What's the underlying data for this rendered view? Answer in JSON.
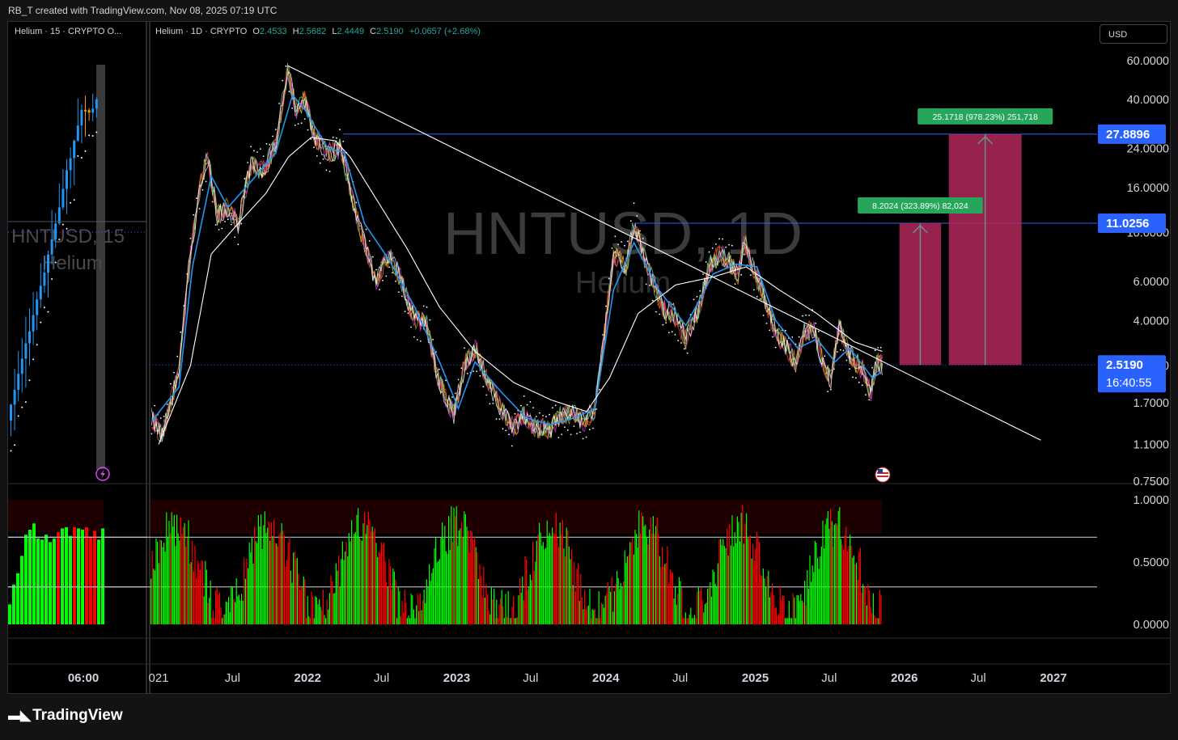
{
  "header": {
    "credit": "RB_T created with TradingView.com, Nov 08, 2025 07:19 UTC"
  },
  "footer": {
    "brand": "TradingView",
    "logo_icon": "tradingview-logo-icon"
  },
  "currency_button": "USD",
  "left_pane": {
    "legend": "Helium · 15 · CRYPTO  O...",
    "watermark_symbol": "HNTUSD, 15",
    "watermark_name": "Helium",
    "time_label": "06:00",
    "alert_icon": "lightning-alert-icon"
  },
  "main_pane": {
    "legend": {
      "name": "Helium · 1D · CRYPTO",
      "o_label": "O",
      "o_value": "2.4533",
      "h_label": "H",
      "h_value": "2.5682",
      "l_label": "L",
      "l_value": "2.4449",
      "c_label": "C",
      "c_value": "2.5190",
      "change": "+0.0657 (+2.68%)"
    },
    "watermark_symbol": "HNTUSD, 1D",
    "watermark_name": "Helium",
    "flag_icon": "us-flag-icon"
  },
  "colors": {
    "background": "#000000",
    "up": "#00ff00",
    "down": "#ff0000",
    "accent_blue": "#2962ff",
    "target_box": "#b2285a",
    "label_green": "#26a65b",
    "ma_fast": "#2196f3",
    "ma_slow": "#ffffff"
  },
  "chart_data": [
    {
      "type": "line",
      "scale": "log",
      "x_axis": {
        "tick_labels": [
          "021",
          "Jul",
          "2022",
          "Jul",
          "2023",
          "Jul",
          "2024",
          "Jul",
          "2025",
          "Jul",
          "2026",
          "Jul",
          "2027"
        ],
        "bold_ticks": [
          "2022",
          "2023",
          "2024",
          "2025",
          "2026",
          "2027"
        ]
      },
      "y_axis": {
        "tick_values": [
          60,
          40,
          24,
          16,
          10,
          6,
          4,
          2.5,
          1.7,
          1.1,
          0.75
        ],
        "tick_labels": [
          "60.0000",
          "40.0000",
          "24.0000",
          "16.0000",
          "10.0000",
          "6.0000",
          "4.0000",
          "2.5000",
          "1.7000",
          "1.1000",
          "0.7500"
        ],
        "ylim": [
          0.72,
          78
        ]
      },
      "price_labels": [
        {
          "value": 27.8896,
          "label": "27.8896"
        },
        {
          "value": 11.0256,
          "label": "11.0256"
        },
        {
          "value": 2.519,
          "label": "2.5190",
          "countdown": "16:40:55"
        }
      ],
      "series": [
        {
          "role": "price",
          "points": [
            [
              "2020-12-15",
              1.45
            ],
            [
              "2021-01-10",
              1.2
            ],
            [
              "2021-02-20",
              2.4
            ],
            [
              "2021-03-20",
              8
            ],
            [
              "2021-04-15",
              17
            ],
            [
              "2021-05-01",
              22
            ],
            [
              "2021-05-25",
              12
            ],
            [
              "2021-06-20",
              13
            ],
            [
              "2021-07-15",
              11
            ],
            [
              "2021-08-15",
              20
            ],
            [
              "2021-09-15",
              19
            ],
            [
              "2021-10-15",
              25
            ],
            [
              "2021-11-13",
              55
            ],
            [
              "2021-12-05",
              35
            ],
            [
              "2021-12-25",
              40
            ],
            [
              "2022-01-20",
              27
            ],
            [
              "2022-02-20",
              23
            ],
            [
              "2022-03-25",
              24
            ],
            [
              "2022-04-30",
              12
            ],
            [
              "2022-05-20",
              9
            ],
            [
              "2022-06-18",
              6
            ],
            [
              "2022-07-20",
              8
            ],
            [
              "2022-08-20",
              6
            ],
            [
              "2022-09-15",
              4.2
            ],
            [
              "2022-10-20",
              3.8
            ],
            [
              "2022-11-15",
              2.2
            ],
            [
              "2022-12-25",
              1.5
            ],
            [
              "2023-01-20",
              2.5
            ],
            [
              "2023-02-15",
              3
            ],
            [
              "2023-03-15",
              2.2
            ],
            [
              "2023-04-20",
              1.6
            ],
            [
              "2023-05-20",
              1.3
            ],
            [
              "2023-06-15",
              1.5
            ],
            [
              "2023-07-15",
              1.3
            ],
            [
              "2023-08-20",
              1.3
            ],
            [
              "2023-09-15",
              1.5
            ],
            [
              "2023-10-15",
              1.5
            ],
            [
              "2023-11-10",
              1.4
            ],
            [
              "2023-12-05",
              1.6
            ],
            [
              "2023-12-25",
              3
            ],
            [
              "2024-01-20",
              8
            ],
            [
              "2024-02-20",
              7
            ],
            [
              "2024-03-10",
              11
            ],
            [
              "2024-04-01",
              8
            ],
            [
              "2024-04-25",
              6
            ],
            [
              "2024-05-20",
              4.5
            ],
            [
              "2024-06-15",
              4.3
            ],
            [
              "2024-07-15",
              3.3
            ],
            [
              "2024-08-15",
              4.5
            ],
            [
              "2024-09-10",
              7
            ],
            [
              "2024-10-05",
              8
            ],
            [
              "2024-10-25",
              7.5
            ],
            [
              "2024-11-20",
              6.5
            ],
            [
              "2024-12-05",
              9.3
            ],
            [
              "2024-12-25",
              7
            ],
            [
              "2025-01-25",
              5
            ],
            [
              "2025-02-20",
              3.5
            ],
            [
              "2025-03-20",
              3
            ],
            [
              "2025-04-10",
              2.6
            ],
            [
              "2025-05-01",
              3.6
            ],
            [
              "2025-05-25",
              3.6
            ],
            [
              "2025-06-20",
              2.4
            ],
            [
              "2025-07-05",
              2.2
            ],
            [
              "2025-07-25",
              3.8
            ],
            [
              "2025-08-20",
              2.8
            ],
            [
              "2025-09-20",
              2.4
            ],
            [
              "2025-10-11",
              1.9
            ],
            [
              "2025-10-25",
              2.6
            ],
            [
              "2025-11-08",
              2.52
            ]
          ]
        },
        {
          "role": "moving-average-fast",
          "points": [
            [
              "2020-12-15",
              1.4
            ],
            [
              "2021-02-20",
              2
            ],
            [
              "2021-03-25",
              7
            ],
            [
              "2021-05-10",
              18
            ],
            [
              "2021-06-20",
              13
            ],
            [
              "2021-08-15",
              17
            ],
            [
              "2021-10-15",
              23
            ],
            [
              "2021-11-25",
              42
            ],
            [
              "2021-12-25",
              36
            ],
            [
              "2022-02-20",
              24
            ],
            [
              "2022-04-01",
              23
            ],
            [
              "2022-05-20",
              11
            ],
            [
              "2022-07-20",
              7.5
            ],
            [
              "2022-09-20",
              4.6
            ],
            [
              "2022-11-20",
              2.6
            ],
            [
              "2023-01-05",
              1.6
            ],
            [
              "2023-02-15",
              2.6
            ],
            [
              "2023-04-20",
              1.9
            ],
            [
              "2023-06-20",
              1.45
            ],
            [
              "2023-08-20",
              1.35
            ],
            [
              "2023-10-15",
              1.45
            ],
            [
              "2023-12-05",
              1.6
            ],
            [
              "2024-01-20",
              5.5
            ],
            [
              "2024-03-10",
              9
            ],
            [
              "2024-05-10",
              5.5
            ],
            [
              "2024-07-15",
              3.8
            ],
            [
              "2024-09-20",
              6.5
            ],
            [
              "2024-11-15",
              7.2
            ],
            [
              "2025-01-05",
              7
            ],
            [
              "2025-02-20",
              4
            ],
            [
              "2025-04-15",
              3
            ],
            [
              "2025-06-01",
              3.3
            ],
            [
              "2025-07-15",
              2.6
            ],
            [
              "2025-08-20",
              3
            ],
            [
              "2025-10-15",
              2.2
            ],
            [
              "2025-11-08",
              2.35
            ]
          ]
        },
        {
          "role": "moving-average-slow",
          "points": [
            [
              "2021-01-01",
              1.1
            ],
            [
              "2021-03-20",
              2.5
            ],
            [
              "2021-05-10",
              8
            ],
            [
              "2021-07-15",
              11
            ],
            [
              "2021-09-20",
              15
            ],
            [
              "2021-11-15",
              22
            ],
            [
              "2022-01-10",
              27
            ],
            [
              "2022-03-10",
              26
            ],
            [
              "2022-04-15",
              22
            ],
            [
              "2022-06-20",
              14
            ],
            [
              "2022-09-01",
              8.5
            ],
            [
              "2022-11-20",
              4.6
            ],
            [
              "2023-02-15",
              2.9
            ],
            [
              "2023-05-20",
              2.1
            ],
            [
              "2023-08-20",
              1.75
            ],
            [
              "2023-11-15",
              1.55
            ],
            [
              "2024-01-10",
              2.2
            ],
            [
              "2024-03-20",
              4.3
            ],
            [
              "2024-06-20",
              5.8
            ],
            [
              "2024-09-20",
              6.3
            ],
            [
              "2024-12-10",
              7
            ],
            [
              "2025-03-01",
              5.5
            ],
            [
              "2025-06-01",
              4.3
            ],
            [
              "2025-09-01",
              3.2
            ],
            [
              "2025-11-08",
              2.9
            ]
          ]
        }
      ],
      "annotations": [
        {
          "type": "trendline",
          "points": [
            [
              "2021-11-13",
              57
            ],
            [
              "2026-12-01",
              1.15
            ]
          ]
        },
        {
          "type": "horizontal-level",
          "value": 27.8896,
          "from": "2022-03-28"
        },
        {
          "type": "horizontal-level",
          "value": 11.0256,
          "from": "2024-03-10"
        },
        {
          "type": "horizontal-level",
          "value": 2.519,
          "style": "dotted",
          "from": "2020-12-01"
        },
        {
          "type": "target-box",
          "x_range": [
            "2025-12-20",
            "2026-04-01"
          ],
          "low": 2.519,
          "high": 11.0256,
          "label": "8.2024 (323.89%) 82,024"
        },
        {
          "type": "target-box",
          "x_range": [
            "2026-04-20",
            "2026-10-15"
          ],
          "low": 2.519,
          "high": 27.8896,
          "label": "25.1718 (978.23%) 251,718"
        }
      ]
    },
    {
      "type": "bar",
      "y_axis": {
        "tick_values": [
          1,
          0.5,
          0
        ],
        "tick_labels": [
          "1.0000",
          "0.5000",
          "0.0000"
        ],
        "ylim": [
          0,
          1
        ]
      },
      "reference_lines": [
        0.7,
        0.3
      ],
      "series": [
        {
          "role": "oscillator-up",
          "color": "up"
        },
        {
          "role": "oscillator-down",
          "color": "down"
        }
      ]
    },
    {
      "type": "bar",
      "pane": "left-15m-oscillator",
      "reference_lines": [
        0.7,
        0.3
      ],
      "values": [
        0.16,
        0.32,
        0.41,
        0.55,
        0.72,
        0.76,
        0.81,
        0.69,
        0.68,
        0.72,
        0.66,
        0.69,
        0.74,
        0.77,
        0.78,
        0.71,
        0.78,
        0.77,
        0.76,
        0.78,
        0.7,
        0.75,
        0.68,
        0.77
      ],
      "up": [
        true,
        true,
        true,
        true,
        true,
        true,
        true,
        true,
        true,
        true,
        true,
        true,
        false,
        true,
        true,
        true,
        false,
        true,
        true,
        false,
        false,
        false,
        true,
        true
      ]
    }
  ]
}
